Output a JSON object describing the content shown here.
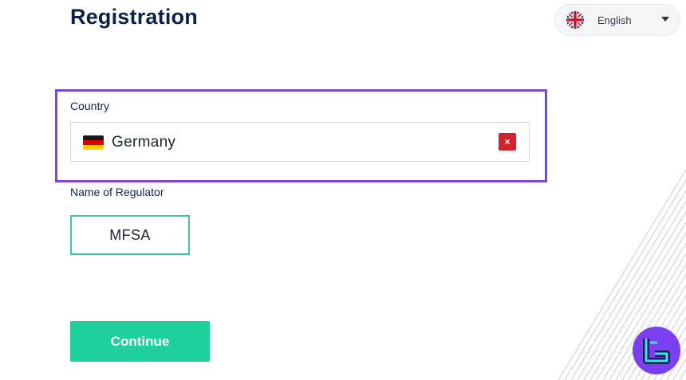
{
  "header": {
    "title": "Registration"
  },
  "language": {
    "selected": "English",
    "flag_icon": "uk-flag-icon",
    "caret_icon": "caret-down-icon"
  },
  "country_field": {
    "label": "Country",
    "value": "Germany",
    "flag_icon": "germany-flag-icon",
    "clear_symbol": "×"
  },
  "regulator_field": {
    "label": "Name of Regulator",
    "value": "MFSA"
  },
  "continue_button": {
    "label": "Continue"
  },
  "colors": {
    "highlight": "#7c45d6",
    "primary": "#1fcf9c",
    "regulator_border": "#3ec9a1",
    "clear": "#d1232a",
    "title": "#0d2145",
    "logo_bg": "#7b3ff2",
    "logo_accent": "#3fe0f5"
  }
}
